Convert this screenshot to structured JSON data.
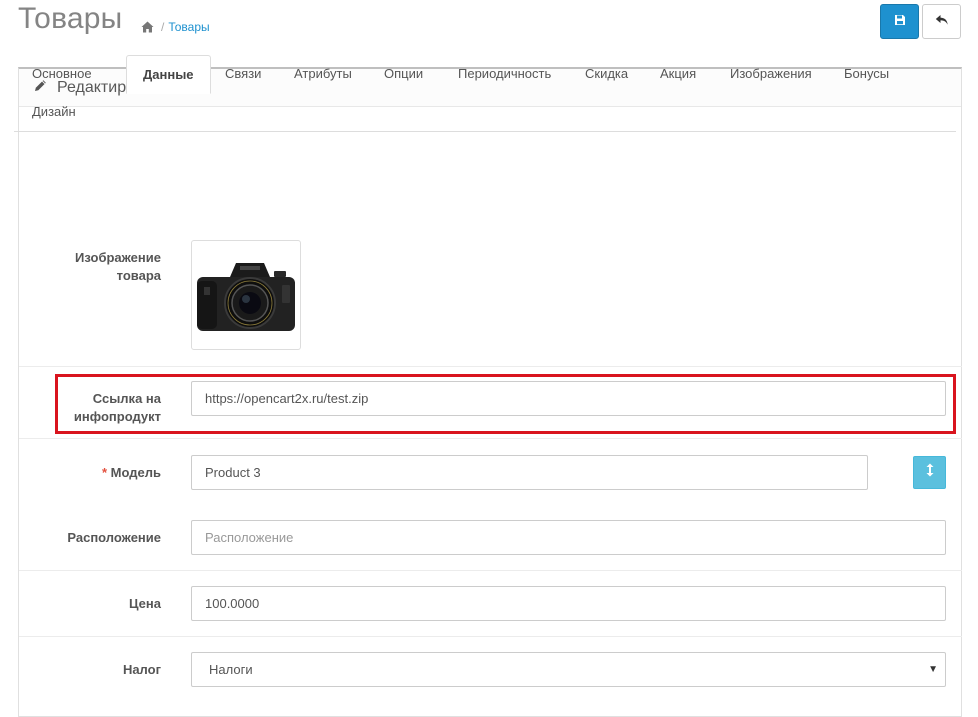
{
  "header": {
    "title": "Товары",
    "breadcrumb": {
      "separator": "/",
      "current": "Товары"
    },
    "buttons": {
      "save_icon": "save-icon",
      "back_icon": "reply-icon"
    }
  },
  "panel": {
    "heading": "Редактирование",
    "heading_icon": "pencil-icon",
    "tabs": [
      {
        "label": "Основное"
      },
      {
        "label": "Данные",
        "active": true
      },
      {
        "label": "Связи"
      },
      {
        "label": "Атрибуты"
      },
      {
        "label": "Опции"
      },
      {
        "label": "Периодичность"
      },
      {
        "label": "Скидка"
      },
      {
        "label": "Акция"
      },
      {
        "label": "Изображения"
      },
      {
        "label": "Бонусы"
      },
      {
        "label": "Дизайн"
      }
    ]
  },
  "form": {
    "image": {
      "label_line1": "Изображение",
      "label_line2": "товара",
      "content": "camera-photo"
    },
    "infoproduct": {
      "label_line1": "Ссылка на",
      "label_line2": "инфопродукт",
      "value": "https://opencart2x.ru/test.zip"
    },
    "model": {
      "required_mark": "*",
      "label": "Модель",
      "value": "Product 3",
      "button_icon": "arrows-vertical-icon"
    },
    "location": {
      "label": "Расположение",
      "placeholder": "Расположение"
    },
    "price": {
      "label": "Цена",
      "value": "100.0000"
    },
    "tax": {
      "label": "Налог",
      "selected": "Налоги"
    }
  },
  "colors": {
    "primary": "#1e91cf",
    "info": "#5bc0de",
    "highlight": "#d9141e",
    "required": "#e3503e"
  }
}
